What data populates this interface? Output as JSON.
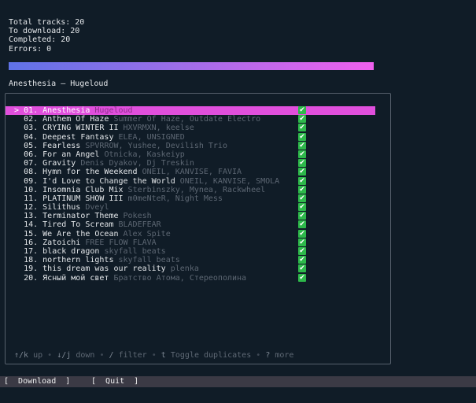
{
  "stats": {
    "total": "Total tracks: 20",
    "to_download": "To download: 20",
    "completed": "Completed: 20",
    "errors": "Errors: 0"
  },
  "progress": {
    "fraction": 1.0
  },
  "now_playing": "Anesthesia – Hugeloud",
  "selector": ">",
  "check_glyph": "✔",
  "tracks": [
    {
      "num": "01.",
      "title": "Anesthesia",
      "artist": "Hugeloud",
      "selected": true
    },
    {
      "num": "02.",
      "title": "Anthem Of Haze",
      "artist": "Summer Of Haze, Outdate Electro"
    },
    {
      "num": "03.",
      "title": "CRYING WINTER II",
      "artist": "HXVRMXN, keelse"
    },
    {
      "num": "04.",
      "title": "Deepest Fantasy",
      "artist": "ELEA, UNSIGNED"
    },
    {
      "num": "05.",
      "title": "Fearless",
      "artist": "SPVRROW, Yushee, Devilish Trio"
    },
    {
      "num": "06.",
      "title": "For an Angel",
      "artist": "Otnicka, Kaskeiyp"
    },
    {
      "num": "07.",
      "title": "Gravity",
      "artist": "Denis Dyakov, Dj Treskin"
    },
    {
      "num": "08.",
      "title": "Hymn for the Weekend",
      "artist": "ONEIL, KANVISE, FAVIA"
    },
    {
      "num": "09.",
      "title": "I'd Love to Change the World",
      "artist": "ONEIL, KANVISE, SMOLA"
    },
    {
      "num": "10.",
      "title": "Insomnia Club Mix",
      "artist": "Sterbinszky, Mynea, Rackwheel"
    },
    {
      "num": "11.",
      "title": "PLATINUM SHOW III",
      "artist": "m0meNteR, Night Mess"
    },
    {
      "num": "12.",
      "title": "Silithus",
      "artist": "Dveyl"
    },
    {
      "num": "13.",
      "title": "Terminator Theme",
      "artist": "Pokesh"
    },
    {
      "num": "14.",
      "title": "Tired To Scream",
      "artist": "BLADEFEAR"
    },
    {
      "num": "15.",
      "title": "We Are the Ocean",
      "artist": "Alex Spite"
    },
    {
      "num": "16.",
      "title": "Zatoichi",
      "artist": "FREE FLOW FLAVA"
    },
    {
      "num": "17.",
      "title": "black dragon",
      "artist": "skyfall beats"
    },
    {
      "num": "18.",
      "title": "northern lights",
      "artist": "skyfall beats"
    },
    {
      "num": "19.",
      "title": "this dream was our reality",
      "artist": "plenka"
    },
    {
      "num": "20.",
      "title": "Ясный мой свет",
      "artist": "Братство Атома, Стереополина"
    }
  ],
  "help": [
    {
      "key": "↑/k",
      "label": "up"
    },
    {
      "key": "↓/j",
      "label": "down"
    },
    {
      "key": "/",
      "label": "filter"
    },
    {
      "key": "t",
      "label": "Toggle duplicates"
    },
    {
      "key": "?",
      "label": "more"
    }
  ],
  "help_separator": "•",
  "buttons": {
    "download": "[  Download  ]",
    "quit": "[  Quit  ]"
  },
  "colors": {
    "background": "#101c27",
    "selected_row": "#e04fdc",
    "check": "#2db84a",
    "progress_start": "#5f72e6",
    "progress_end": "#f160ee"
  }
}
